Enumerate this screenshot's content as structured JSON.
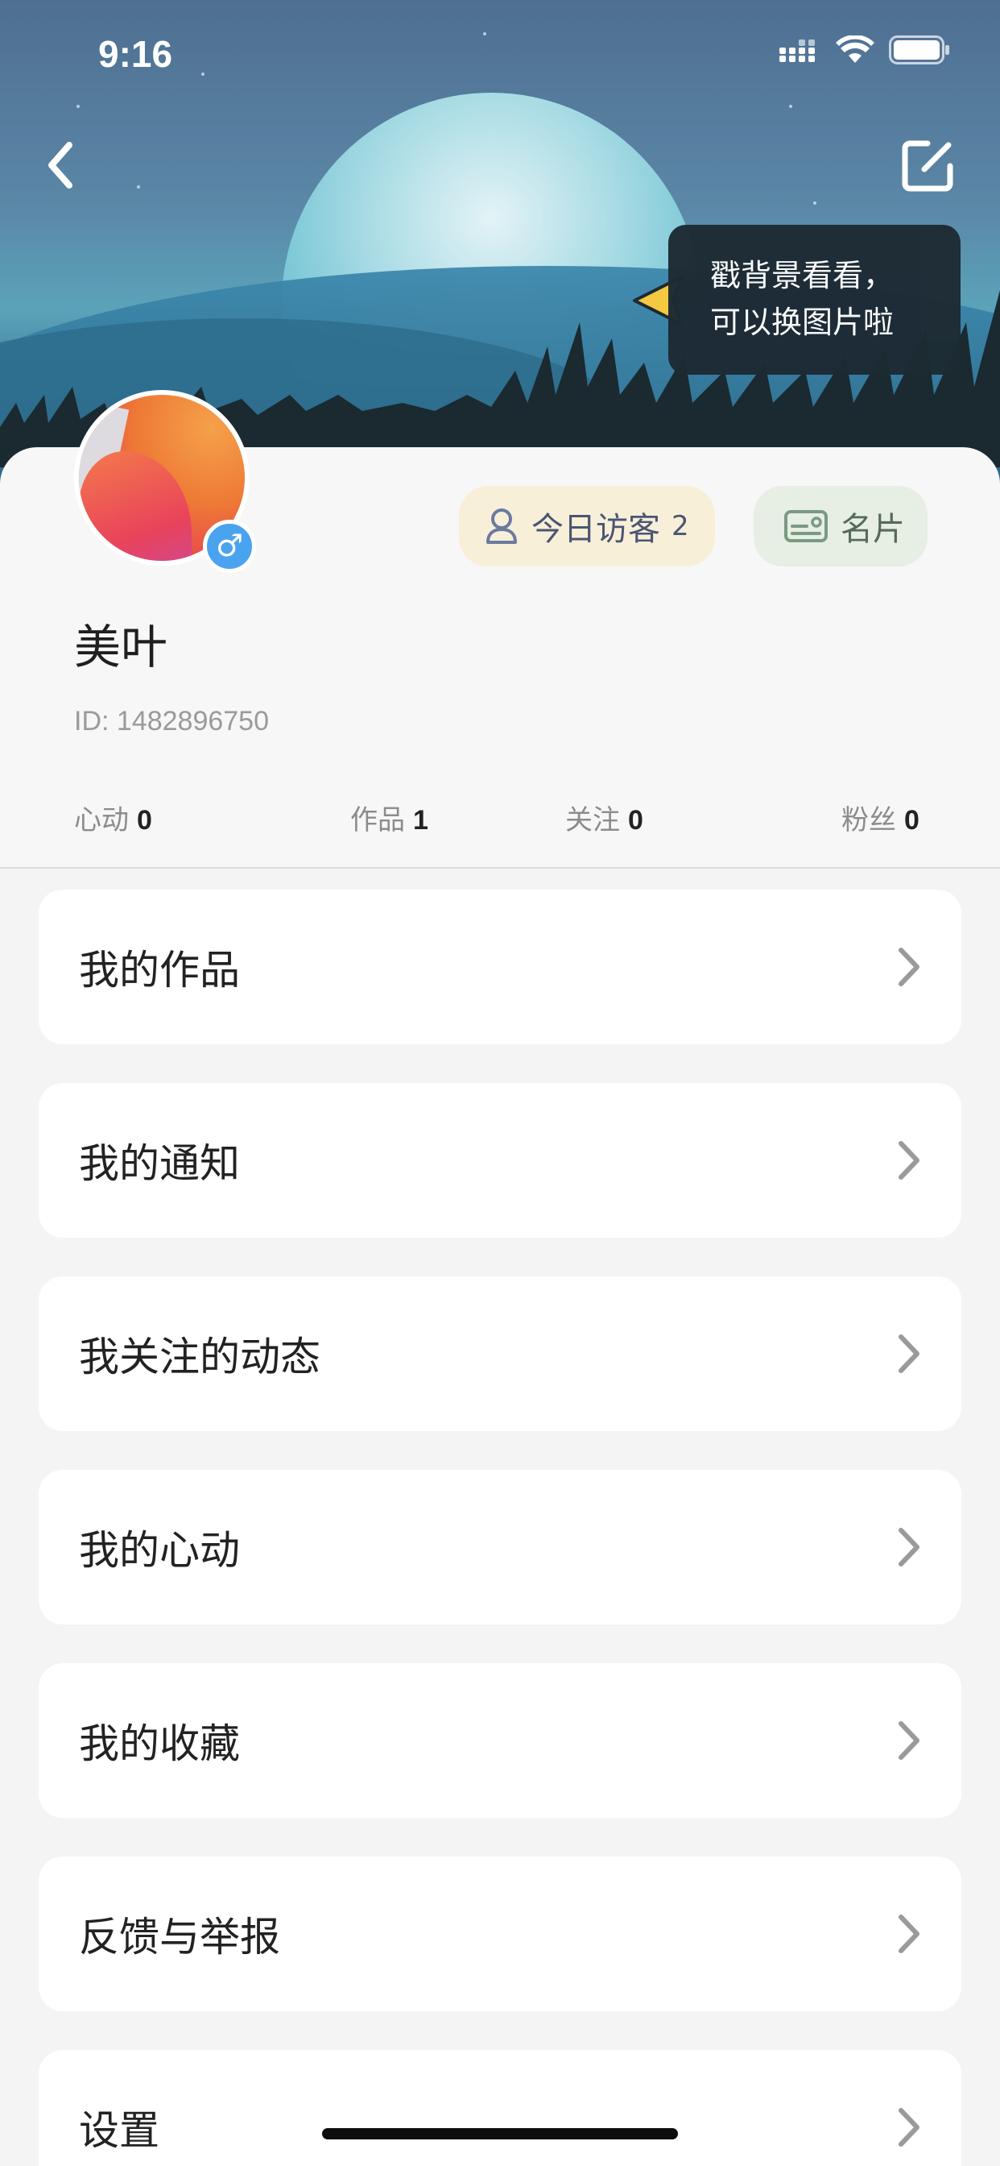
{
  "status_bar": {
    "time": "9:16"
  },
  "tooltip": {
    "line1": "戳背景看看，",
    "line2": "可以换图片啦"
  },
  "profile": {
    "name": "美叶",
    "id_text": "ID: 1482896750",
    "visitors_label": "今日访客",
    "visitors_count": "2",
    "card_label": "名片",
    "gender_symbol": "♂"
  },
  "stats": [
    {
      "label": "心动",
      "value": "0"
    },
    {
      "label": "作品",
      "value": "1"
    },
    {
      "label": "关注",
      "value": "0"
    },
    {
      "label": "粉丝",
      "value": "0"
    }
  ],
  "menu": [
    {
      "label": "我的作品"
    },
    {
      "label": "我的通知"
    },
    {
      "label": "我关注的动态"
    },
    {
      "label": "我的心动"
    },
    {
      "label": "我的收藏"
    },
    {
      "label": "反馈与举报"
    },
    {
      "label": "设置"
    }
  ],
  "colors": {
    "accent_blue": "#4aa3ef",
    "visitor_pill_bg": "#f8efd9",
    "card_pill_bg": "#e7eee4",
    "tooltip_bg": "#1d2a33",
    "tooltip_arrow": "#f5c842"
  },
  "icons": {
    "back": "chevron-left-icon",
    "edit": "edit-square-icon",
    "visitor": "person-icon",
    "card": "id-card-icon",
    "chevron": "chevron-right-icon"
  }
}
